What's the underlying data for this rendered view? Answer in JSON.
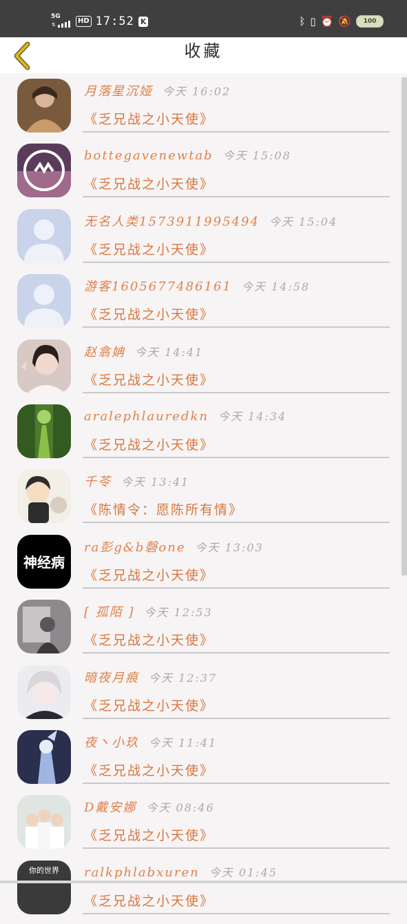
{
  "status_bar": {
    "network": "5G",
    "hd": "HD",
    "time": "17:52",
    "k_badge": "K",
    "battery": "100"
  },
  "header": {
    "title": "收藏"
  },
  "favorites": [
    {
      "name": "月落星沉娅",
      "time": "今天 16:02",
      "title": "《乏兄战之小天使》",
      "avatar": "photo-portrait"
    },
    {
      "name": "bottegavenewtab",
      "time": "今天 15:08",
      "title": "《乏兄战之小天使》",
      "avatar": "dark-circle-logo"
    },
    {
      "name": "无名人类1573911995494",
      "time": "今天 15:04",
      "title": "《乏兄战之小天使》",
      "avatar": "default-person"
    },
    {
      "name": "游客1605677486161",
      "time": "今天 14:58",
      "title": "《乏兄战之小天使》",
      "avatar": "default-person"
    },
    {
      "name": "赵翕姌",
      "time": "今天 14:41",
      "title": "《乏兄战之小天使》",
      "avatar": "photo-girl"
    },
    {
      "name": "aralephlauredkn",
      "time": "今天 14:34",
      "title": "《乏兄战之小天使》",
      "avatar": "photo-forest"
    },
    {
      "name": "千苓",
      "time": "今天 13:41",
      "title": "《陈情令：愿陈所有情》",
      "avatar": "cartoon-boy"
    },
    {
      "name": "ra彭g&b磬one",
      "time": "今天 13:03",
      "title": "《乏兄战之小天使》",
      "avatar": "black-text-logo",
      "avatar_text": "神经病"
    },
    {
      "name": "[ 孤陌 ]",
      "time": "今天 12:53",
      "title": "《乏兄战之小天使》",
      "avatar": "photo-grey"
    },
    {
      "name": "暗夜月痕",
      "time": "今天 12:37",
      "title": "《乏兄战之小天使》",
      "avatar": "anime-white-hair"
    },
    {
      "name": "夜丶小玖",
      "time": "今天 11:41",
      "title": "《乏兄战之小天使》",
      "avatar": "anime-blue"
    },
    {
      "name": "D戴安娜",
      "time": "今天 08:46",
      "title": "《乏兄战之小天使》",
      "avatar": "photo-group"
    },
    {
      "name": "ralkphlabxuren",
      "time": "今天 01:45",
      "title": "《乏兄战之小天使》",
      "avatar": "text-logo-dark",
      "avatar_text": "你的世界"
    }
  ],
  "colors": {
    "name": "#e0814a",
    "title": "#d9763e",
    "time": "#b0a8a0",
    "back_arrow": "#d8b62a"
  }
}
